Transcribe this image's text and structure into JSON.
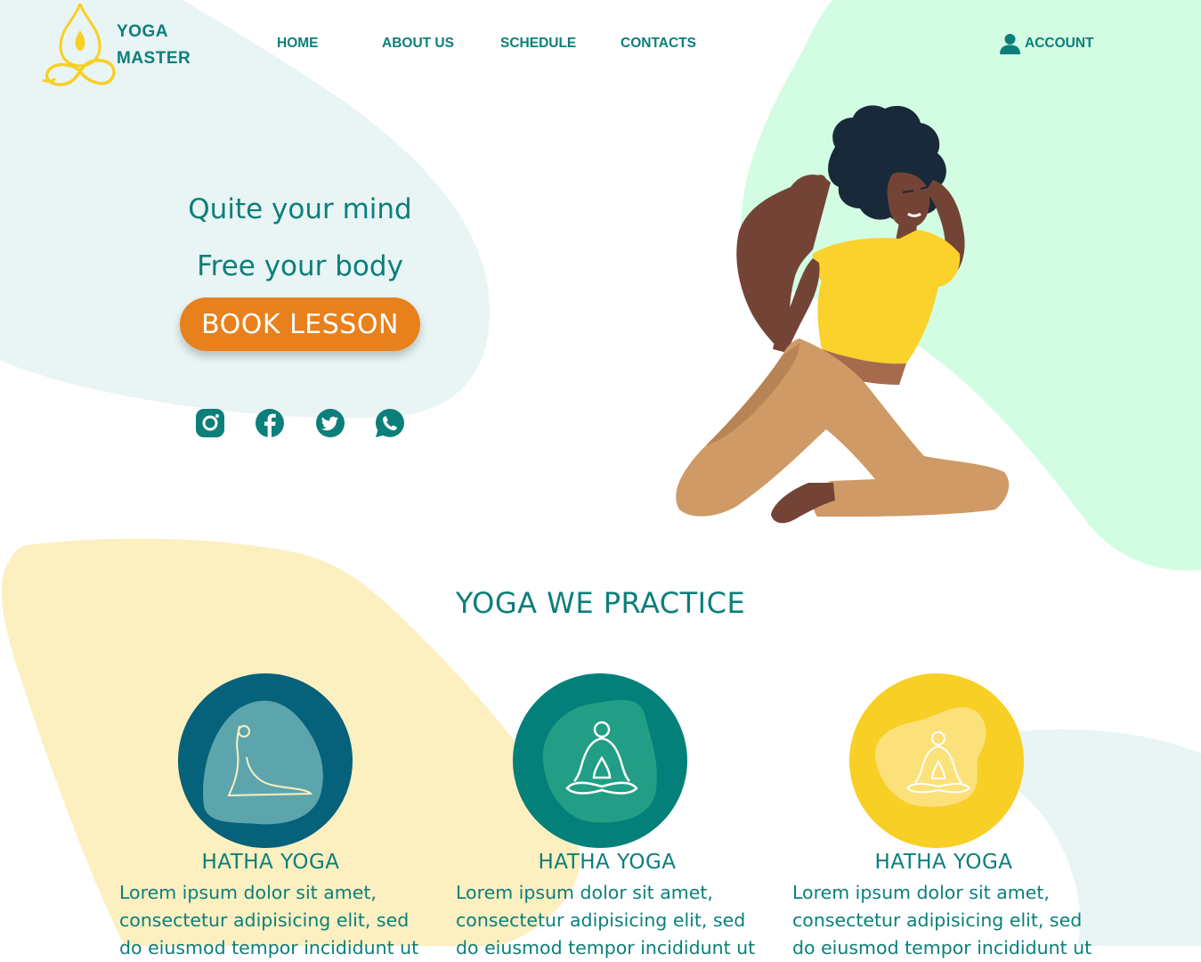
{
  "brand": {
    "line1": "YOGA",
    "line2": "MASTER"
  },
  "nav": {
    "items": [
      "HOME",
      "ABOUT US",
      "SCHEDULE",
      "CONTACTS"
    ],
    "account": "ACCOUNT"
  },
  "hero": {
    "line1": "Quite your mind",
    "line2": "Free your body",
    "button": "BOOK LESSON"
  },
  "social": [
    "instagram-icon",
    "facebook-icon",
    "twitter-icon",
    "whatsapp-icon"
  ],
  "practice": {
    "title": "YOGA WE PRACTICE",
    "cards": [
      {
        "title": "HATHA YOGA",
        "text": "Lorem ipsum dolor sit amet, consectetur adipisicing elit, sed do eiusmod tempor incididunt ut",
        "icon": "cobra-pose-icon"
      },
      {
        "title": "HATHA YOGA",
        "text": "Lorem ipsum dolor sit amet, consectetur adipisicing elit, sed do eiusmod tempor incididunt ut",
        "icon": "lotus-pose-icon"
      },
      {
        "title": "HATHA YOGA",
        "text": "Lorem ipsum dolor sit amet, consectetur adipisicing elit, sed do eiusmod tempor incididunt ut",
        "icon": "lotus-pose-icon"
      }
    ]
  },
  "colors": {
    "primary": "#0b7f7a",
    "accent": "#e8801c",
    "yellow": "#f8cf24",
    "navy": "#06617a",
    "mint": "#d2fde3",
    "pale": "#e9f4f4",
    "cream": "#fcefc0"
  }
}
